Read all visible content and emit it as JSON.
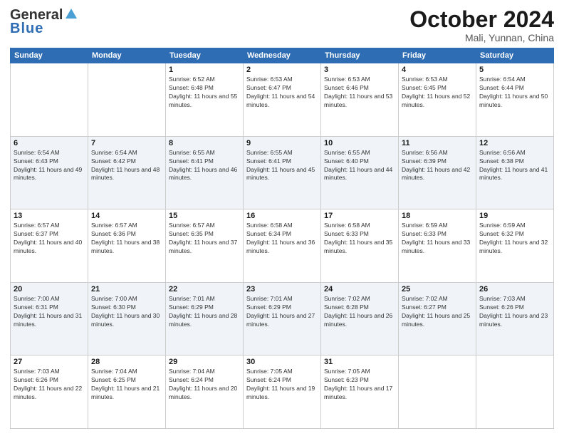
{
  "header": {
    "logo_line1": "General",
    "logo_line2": "Blue",
    "month": "October 2024",
    "location": "Mali, Yunnan, China"
  },
  "weekdays": [
    "Sunday",
    "Monday",
    "Tuesday",
    "Wednesday",
    "Thursday",
    "Friday",
    "Saturday"
  ],
  "weeks": [
    [
      {
        "day": "",
        "info": ""
      },
      {
        "day": "",
        "info": ""
      },
      {
        "day": "1",
        "info": "Sunrise: 6:52 AM\nSunset: 6:48 PM\nDaylight: 11 hours and 55 minutes."
      },
      {
        "day": "2",
        "info": "Sunrise: 6:53 AM\nSunset: 6:47 PM\nDaylight: 11 hours and 54 minutes."
      },
      {
        "day": "3",
        "info": "Sunrise: 6:53 AM\nSunset: 6:46 PM\nDaylight: 11 hours and 53 minutes."
      },
      {
        "day": "4",
        "info": "Sunrise: 6:53 AM\nSunset: 6:45 PM\nDaylight: 11 hours and 52 minutes."
      },
      {
        "day": "5",
        "info": "Sunrise: 6:54 AM\nSunset: 6:44 PM\nDaylight: 11 hours and 50 minutes."
      }
    ],
    [
      {
        "day": "6",
        "info": "Sunrise: 6:54 AM\nSunset: 6:43 PM\nDaylight: 11 hours and 49 minutes."
      },
      {
        "day": "7",
        "info": "Sunrise: 6:54 AM\nSunset: 6:42 PM\nDaylight: 11 hours and 48 minutes."
      },
      {
        "day": "8",
        "info": "Sunrise: 6:55 AM\nSunset: 6:41 PM\nDaylight: 11 hours and 46 minutes."
      },
      {
        "day": "9",
        "info": "Sunrise: 6:55 AM\nSunset: 6:41 PM\nDaylight: 11 hours and 45 minutes."
      },
      {
        "day": "10",
        "info": "Sunrise: 6:55 AM\nSunset: 6:40 PM\nDaylight: 11 hours and 44 minutes."
      },
      {
        "day": "11",
        "info": "Sunrise: 6:56 AM\nSunset: 6:39 PM\nDaylight: 11 hours and 42 minutes."
      },
      {
        "day": "12",
        "info": "Sunrise: 6:56 AM\nSunset: 6:38 PM\nDaylight: 11 hours and 41 minutes."
      }
    ],
    [
      {
        "day": "13",
        "info": "Sunrise: 6:57 AM\nSunset: 6:37 PM\nDaylight: 11 hours and 40 minutes."
      },
      {
        "day": "14",
        "info": "Sunrise: 6:57 AM\nSunset: 6:36 PM\nDaylight: 11 hours and 38 minutes."
      },
      {
        "day": "15",
        "info": "Sunrise: 6:57 AM\nSunset: 6:35 PM\nDaylight: 11 hours and 37 minutes."
      },
      {
        "day": "16",
        "info": "Sunrise: 6:58 AM\nSunset: 6:34 PM\nDaylight: 11 hours and 36 minutes."
      },
      {
        "day": "17",
        "info": "Sunrise: 6:58 AM\nSunset: 6:33 PM\nDaylight: 11 hours and 35 minutes."
      },
      {
        "day": "18",
        "info": "Sunrise: 6:59 AM\nSunset: 6:33 PM\nDaylight: 11 hours and 33 minutes."
      },
      {
        "day": "19",
        "info": "Sunrise: 6:59 AM\nSunset: 6:32 PM\nDaylight: 11 hours and 32 minutes."
      }
    ],
    [
      {
        "day": "20",
        "info": "Sunrise: 7:00 AM\nSunset: 6:31 PM\nDaylight: 11 hours and 31 minutes."
      },
      {
        "day": "21",
        "info": "Sunrise: 7:00 AM\nSunset: 6:30 PM\nDaylight: 11 hours and 30 minutes."
      },
      {
        "day": "22",
        "info": "Sunrise: 7:01 AM\nSunset: 6:29 PM\nDaylight: 11 hours and 28 minutes."
      },
      {
        "day": "23",
        "info": "Sunrise: 7:01 AM\nSunset: 6:29 PM\nDaylight: 11 hours and 27 minutes."
      },
      {
        "day": "24",
        "info": "Sunrise: 7:02 AM\nSunset: 6:28 PM\nDaylight: 11 hours and 26 minutes."
      },
      {
        "day": "25",
        "info": "Sunrise: 7:02 AM\nSunset: 6:27 PM\nDaylight: 11 hours and 25 minutes."
      },
      {
        "day": "26",
        "info": "Sunrise: 7:03 AM\nSunset: 6:26 PM\nDaylight: 11 hours and 23 minutes."
      }
    ],
    [
      {
        "day": "27",
        "info": "Sunrise: 7:03 AM\nSunset: 6:26 PM\nDaylight: 11 hours and 22 minutes."
      },
      {
        "day": "28",
        "info": "Sunrise: 7:04 AM\nSunset: 6:25 PM\nDaylight: 11 hours and 21 minutes."
      },
      {
        "day": "29",
        "info": "Sunrise: 7:04 AM\nSunset: 6:24 PM\nDaylight: 11 hours and 20 minutes."
      },
      {
        "day": "30",
        "info": "Sunrise: 7:05 AM\nSunset: 6:24 PM\nDaylight: 11 hours and 19 minutes."
      },
      {
        "day": "31",
        "info": "Sunrise: 7:05 AM\nSunset: 6:23 PM\nDaylight: 11 hours and 17 minutes."
      },
      {
        "day": "",
        "info": ""
      },
      {
        "day": "",
        "info": ""
      }
    ]
  ]
}
